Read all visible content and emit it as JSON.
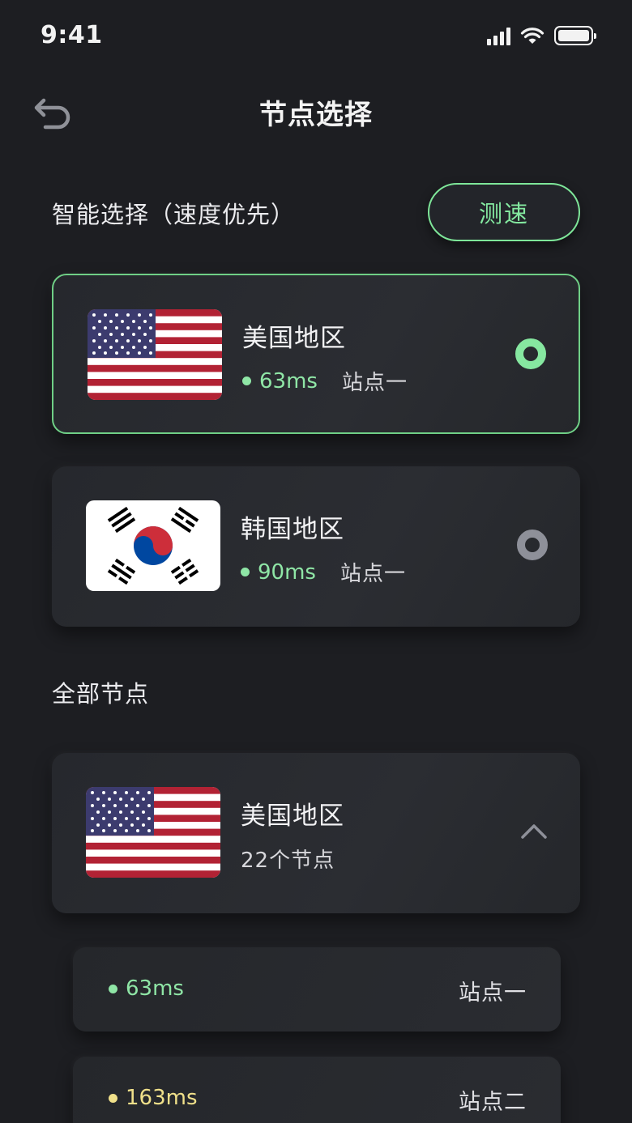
{
  "status": {
    "time": "9:41"
  },
  "header": {
    "title": "节点选择"
  },
  "smart": {
    "title": "智能选择（速度优先）",
    "speedtest_label": "测速",
    "cards": [
      {
        "region": "美国地区",
        "ping": "63ms",
        "site": "站点一",
        "selected": true,
        "flag": "us-flag"
      },
      {
        "region": "韩国地区",
        "ping": "90ms",
        "site": "站点一",
        "selected": false,
        "flag": "kr-flag"
      }
    ]
  },
  "all": {
    "title": "全部节点",
    "group": {
      "region": "美国地区",
      "count": "22个节点",
      "expanded": true
    },
    "nodes": [
      {
        "ping": "63ms",
        "site": "站点一",
        "color": "#8fe6a6"
      },
      {
        "ping": "163ms",
        "site": "站点二",
        "color": "#f0e08a"
      }
    ]
  },
  "colors": {
    "accent": "#7ee699",
    "background": "#1d1e22",
    "card": "#2a2c31",
    "warn": "#f0e08a"
  }
}
